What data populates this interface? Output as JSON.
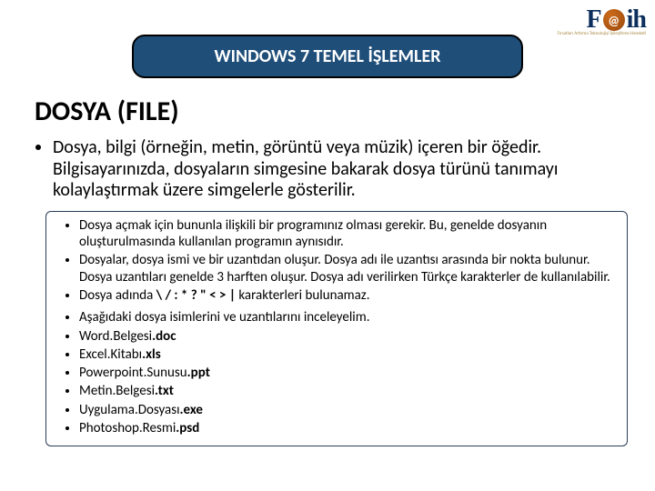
{
  "logo": {
    "f": "F",
    "at": "@",
    "ih": "ih",
    "subtitle": "Fırsatları Artırma Teknolojiyi İyileştirme Hareketi"
  },
  "title_pill": "WINDOWS 7 TEMEL İŞLEMLER",
  "subtitle": "DOSYA (FILE)",
  "lead": "Dosya, bilgi (örneğin, metin, görüntü veya müzik) içeren bir öğedir. Bilgisayarınızda, dosyaların simgesine bakarak dosya türünü tanımayı kolaylaştırmak üzere simgelerle gösterilir.",
  "box": {
    "b1": "Dosya açmak için bununla ilişkili bir programınız olması gerekir. Bu, genelde dosyanın oluşturulmasında kullanılan programın aynısıdır.",
    "b2": "Dosyalar, dosya ismi ve bir uzantıdan oluşur. Dosya adı ile uzantısı arasında bir nokta bulunur. Dosya uzantıları genelde 3 harften oluşur. Dosya adı verilirken Türkçe karakterler de kullanılabilir.",
    "b3_pre": "Dosya adında ",
    "b3_chars": "\\ / : * ? \" < > |",
    "b3_post": " karakterleri bulunamaz.",
    "examine": "Aşağıdaki dosya isimlerini ve uzantılarını inceleyelim.",
    "examples": [
      {
        "name": "Word.Belgesi",
        "ext": ".doc"
      },
      {
        "name": "Excel.Kitabı",
        "ext": ".xls"
      },
      {
        "name": "Powerpoint.Sunusu",
        "ext": ".ppt"
      },
      {
        "name": "Metin.Belgesi",
        "ext": ".txt"
      },
      {
        "name": "Uygulama.Dosyası",
        "ext": ".exe"
      },
      {
        "name": "Photoshop.Resmi",
        "ext": ".psd"
      }
    ]
  }
}
